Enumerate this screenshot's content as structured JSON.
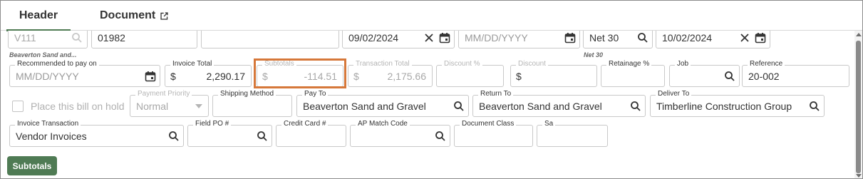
{
  "tabs": {
    "header": "Header",
    "document": "Document"
  },
  "row1": {
    "vendor_value": "V111",
    "vendor_caption": "Beaverton Sand and...",
    "invoice_number": "01982",
    "invoice_date": "09/02/2024",
    "due_date_placeholder": "MM/DD/YYYY",
    "terms": "Net 30",
    "terms_caption": "Net 30",
    "discount_date": "10/02/2024"
  },
  "row2": {
    "recommended_label": "Recommended to pay on",
    "recommended_placeholder": "MM/DD/YYYY",
    "invoice_total_label": "Invoice Total",
    "invoice_total_value": "2,290.17",
    "subtotals_label": "Subtotals",
    "subtotals_value": "-114.51",
    "transaction_total_label": "Transaction Total",
    "transaction_total_value": "2,175.66",
    "discount_pct_label": "Discount %",
    "discount_label": "Discount",
    "retainage_label": "Retainage %",
    "job_label": "Job",
    "reference_label": "Reference",
    "reference_value": "20-002",
    "currency_symbol": "$"
  },
  "row3": {
    "hold_label": "Place this bill on hold",
    "payment_priority_label": "Payment Priority",
    "payment_priority_value": "Normal",
    "shipping_method_label": "Shipping Method",
    "pay_to_label": "Pay To",
    "pay_to_value": "Beaverton Sand and Gravel",
    "return_to_label": "Return To",
    "return_to_value": "Beaverton Sand and Gravel",
    "deliver_to_label": "Deliver To",
    "deliver_to_value": "Timberline Construction Group"
  },
  "row4": {
    "invoice_transaction_label": "Invoice Transaction",
    "invoice_transaction_value": "Vendor Invoices",
    "field_po_label": "Field PO #",
    "credit_card_label": "Credit Card #",
    "ap_match_label": "AP Match Code",
    "document_class_label": "Document Class",
    "sa_label": "Sa"
  },
  "buttons": {
    "subtotals": "Subtotals"
  },
  "colors": {
    "accent": "#4f7b54",
    "highlight": "#d6783a"
  },
  "icons": [
    "search-icon",
    "calendar-icon",
    "clear-icon",
    "external-link-icon",
    "dropdown-arrow-icon"
  ]
}
